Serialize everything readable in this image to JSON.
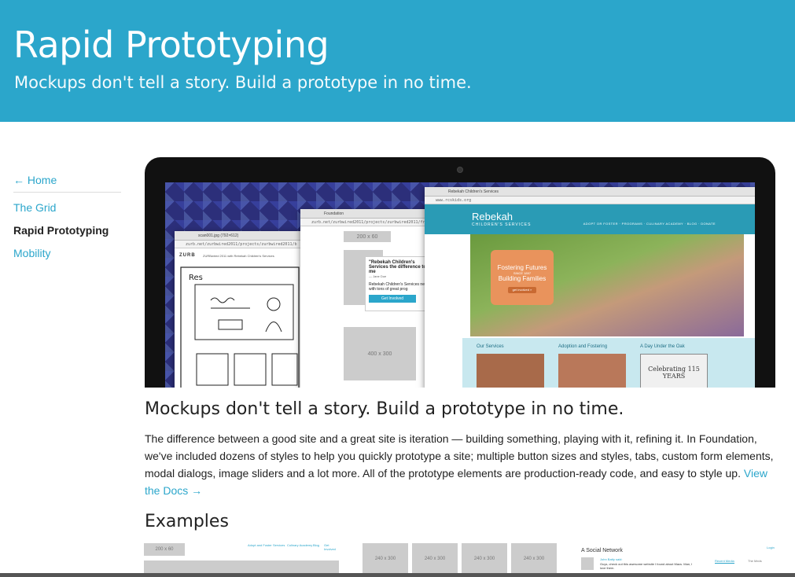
{
  "header": {
    "title": "Rapid Prototyping",
    "subtitle": "Mockups don't tell a story. Build a prototype in no time."
  },
  "sidebar": {
    "home_label": "← Home",
    "items": [
      {
        "label": "The Grid",
        "active": false
      },
      {
        "label": "Rapid Prototyping",
        "active": true
      },
      {
        "label": "Mobility",
        "active": false
      }
    ]
  },
  "hero_image": {
    "win1_url": "zurb.net/zurbwired2011/projects/zurbwired2011/b",
    "win1_tab": "scan001.jpg (792×612)",
    "win1_note": "ZURBwired 2011 with Rebekah Children's Services",
    "win1_logo": "ZURB",
    "win2_tab": "Foundation",
    "win2_url": "zurb.net/zurbwired2011/projects/zurbwired2011/frame/ges",
    "win2_box1": "200 x 60",
    "win2_box2": "400 x 300",
    "win2_quote": "\"Rebekah Children's Services the difference to me",
    "win2_quote_author": "— Jane Doe",
    "win2_text": "Rebekah Children's Services need with tons of great prog",
    "win2_button": "Get Involved",
    "win3_tab": "Rebekah Children's Services",
    "win3_url": "www.rcskids.org",
    "site_name": "Rebekah",
    "site_tag": "CHILDREN'S SERVICES",
    "site_nav": "ADOPT OR FOSTER · PROGRAMS · CULINARY ACADEMY · BLOG · DONATE",
    "badge_line1": "Fostering Futures",
    "badge_since": "SINCE 1897",
    "badge_line2": "Building Families",
    "badge_button": "get involved »",
    "col1": "Our Services",
    "col2": "Adoption and Fostering",
    "col3": "A Day Under the Oak",
    "celebrating": "Celebrating 115 YEARS"
  },
  "content": {
    "title": "Mockups don't tell a story. Build a prototype in no time.",
    "paragraph": "The difference between a good site and a great site is iteration — building something, playing with it, refining it. In Foundation, we've included dozens of styles to help you quickly prototype a site; multiple button sizes and styles, tabs, custom form elements, modal dialogs, image sliders and a lot more. All of the prototype elements are production-ready code, and easy to style up.",
    "docs_link": "View the Docs →",
    "examples_title": "Examples"
  },
  "examples": {
    "ex1_box": "200 x 60",
    "ex1_nav": [
      "Adopt and Foster",
      "Services",
      "Culinary Academy",
      "Blog",
      "Get Involved"
    ],
    "grid_label": "240 x 300",
    "social_title": "A Social Network",
    "social_login": "Login",
    "social_user": "John Batty said:",
    "social_post": "Guys, check out this awesome website I found about Macs. Man, I love them.",
    "social_tab1": "Recent Media",
    "social_tab2": "The Meds"
  },
  "colors": {
    "brand": "#2ba6cb"
  }
}
